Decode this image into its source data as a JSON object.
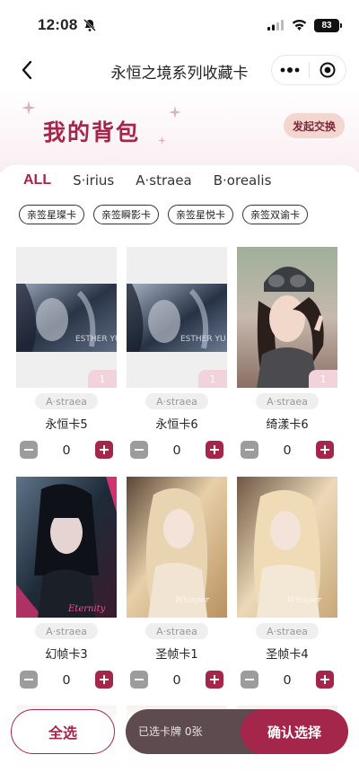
{
  "status": {
    "time": "12:08",
    "battery": "83"
  },
  "nav": {
    "title": "永恒之境系列收藏卡"
  },
  "header": {
    "title": "我的背包",
    "exchange_label": "发起交换"
  },
  "tabs": [
    {
      "label": "ALL",
      "active": true
    },
    {
      "label": "S·irius",
      "active": false
    },
    {
      "label": "A·straea",
      "active": false
    },
    {
      "label": "B·orealis",
      "active": false
    }
  ],
  "chips": [
    "亲签星璨卡",
    "亲签瞬影卡",
    "亲签星悦卡",
    "亲签双谕卡"
  ],
  "cards": [
    {
      "name": "永恒卡5",
      "series": "A·straea",
      "count": "0",
      "owned": "1"
    },
    {
      "name": "永恒卡6",
      "series": "A·straea",
      "count": "0",
      "owned": "1"
    },
    {
      "name": "绮漾卡6",
      "series": "A·straea",
      "count": "0",
      "owned": "1"
    },
    {
      "name": "幻帧卡3",
      "series": "A·straea",
      "count": "0",
      "owned": ""
    },
    {
      "name": "圣帧卡1",
      "series": "A·straea",
      "count": "0",
      "owned": ""
    },
    {
      "name": "圣帧卡4",
      "series": "A·straea",
      "count": "0",
      "owned": ""
    }
  ],
  "bottom": {
    "select_all": "全选",
    "selected_text": "已选卡牌 0张",
    "confirm": "确认选择"
  },
  "colors": {
    "accent": "#a4264b",
    "chip_bg": "#f4d6d0"
  }
}
